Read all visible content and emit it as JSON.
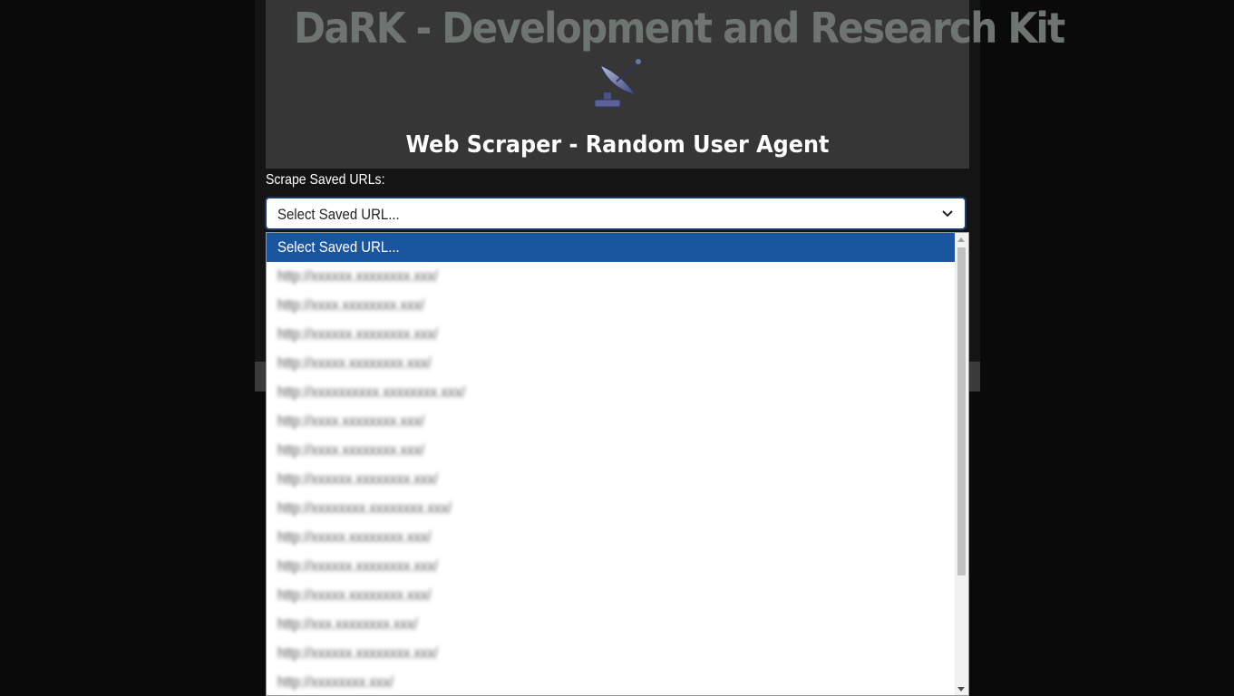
{
  "header": {
    "title": "DaRK - Development and Research Kit",
    "logo_icon": "satellite-dish-icon",
    "subtitle": "Web Scraper - Random User Agent"
  },
  "scrape": {
    "label": "Scrape Saved URLs:",
    "selected_value": "Select Saved URL...",
    "options": [
      {
        "label": "Select Saved URL...",
        "selected": true
      },
      {
        "label": "http://xxxxxx.xxxxxxxx.xxx/",
        "blurred": true
      },
      {
        "label": "http://xxxx.xxxxxxxx.xxx/",
        "blurred": true
      },
      {
        "label": "http://xxxxxx.xxxxxxxx.xxx/",
        "blurred": true
      },
      {
        "label": "http://xxxxx.xxxxxxxx.xxx/",
        "blurred": true
      },
      {
        "label": "http://xxxxxxxxxx.xxxxxxxx.xxx/",
        "blurred": true
      },
      {
        "label": "http://xxxx.xxxxxxxx.xxx/",
        "blurred": true
      },
      {
        "label": "http://xxxx.xxxxxxxx.xxx/",
        "blurred": true
      },
      {
        "label": "http://xxxxxx.xxxxxxxx.xxx/",
        "blurred": true
      },
      {
        "label": "http://xxxxxxxx.xxxxxxxx.xxx/",
        "blurred": true
      },
      {
        "label": "http://xxxxx.xxxxxxxx.xxx/",
        "blurred": true
      },
      {
        "label": "http://xxxxxx.xxxxxxxx.xxx/",
        "blurred": true
      },
      {
        "label": "http://xxxxx.xxxxxxxx.xxx/",
        "blurred": true
      },
      {
        "label": "http://xxx.xxxxxxxx.xxx/",
        "blurred": true
      },
      {
        "label": "http://xxxxxx.xxxxxxxx.xxx/",
        "blurred": true
      },
      {
        "label": "http://xxxxxxxx.xxx/",
        "blurred": true
      }
    ]
  },
  "colors": {
    "accent": "#1a55a0",
    "header_bg": "#363636",
    "title_color": "#6e7470"
  }
}
